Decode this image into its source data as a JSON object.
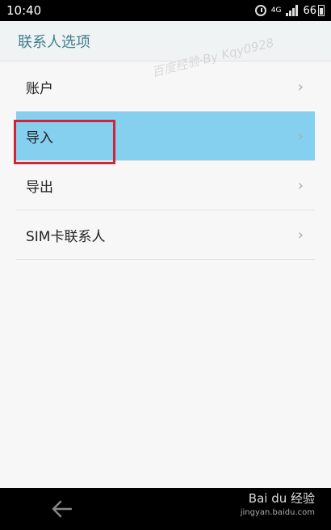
{
  "status": {
    "time": "10:40",
    "battery": "66",
    "network": "4G"
  },
  "header": {
    "title": "联系人选项"
  },
  "list": {
    "items": [
      {
        "label": "账户"
      },
      {
        "label": "导入"
      },
      {
        "label": "导出"
      },
      {
        "label": "SIM卡联系人"
      }
    ],
    "chevron": "›"
  },
  "watermark": "百度经验·By Kqy0928",
  "footer": {
    "logo_text": "Bai du 经验",
    "logo_sub": "jingyan.baidu.com"
  },
  "colors": {
    "selected_row": "#84d0ee",
    "title_color": "#3f7f8d",
    "highlight_border": "#d0243a"
  }
}
